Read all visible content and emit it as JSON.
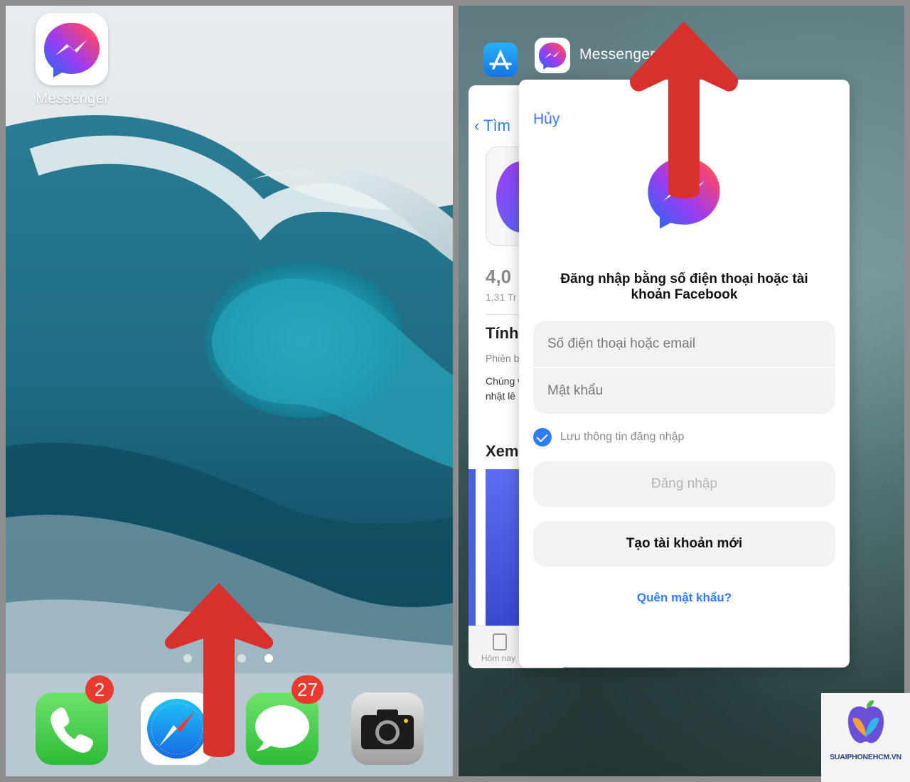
{
  "home": {
    "messenger_label": "Messenger",
    "page_dots": 4,
    "active_page_dot": 4,
    "dock": [
      {
        "app": "Phone",
        "icon": "phone-icon",
        "badge": "2"
      },
      {
        "app": "Safari",
        "icon": "safari-compass-icon",
        "badge": ""
      },
      {
        "app": "Messages",
        "icon": "messages-bubble-icon",
        "badge": "27"
      },
      {
        "app": "Camera",
        "icon": "camera-icon",
        "badge": ""
      }
    ]
  },
  "switcher": {
    "messenger_label": "Messenger",
    "appstore": {
      "back_label": "Tìm",
      "rating": "4,0",
      "rating_count": "1,31 Tr",
      "section_title": "Tính",
      "section_sub": "Phiên b",
      "body_text": "Chúng với nhữ nhật lê",
      "section2_title": "Xem",
      "tab_label": "Hôm nay"
    },
    "login": {
      "cancel": "Hủy",
      "title": "Đăng nhập bằng số điện thoại hoặc tài khoản Facebook",
      "user_placeholder": "Số điện thoại hoặc email",
      "pass_placeholder": "Mật khẩu",
      "save_label": "Lưu thông tin đăng nhập",
      "save_checked": true,
      "login_button": "Đăng nhập",
      "create_button": "Tạo tài khoản mới",
      "forgot_link": "Quên mật khẩu?"
    }
  },
  "watermark": {
    "text": "SUAIPHONEHCM.VN"
  },
  "colors": {
    "arrow": "#d8302c",
    "link_blue": "#2f7cf6",
    "badge_red": "#ea3a30",
    "field_bg": "#f2f2f2"
  }
}
